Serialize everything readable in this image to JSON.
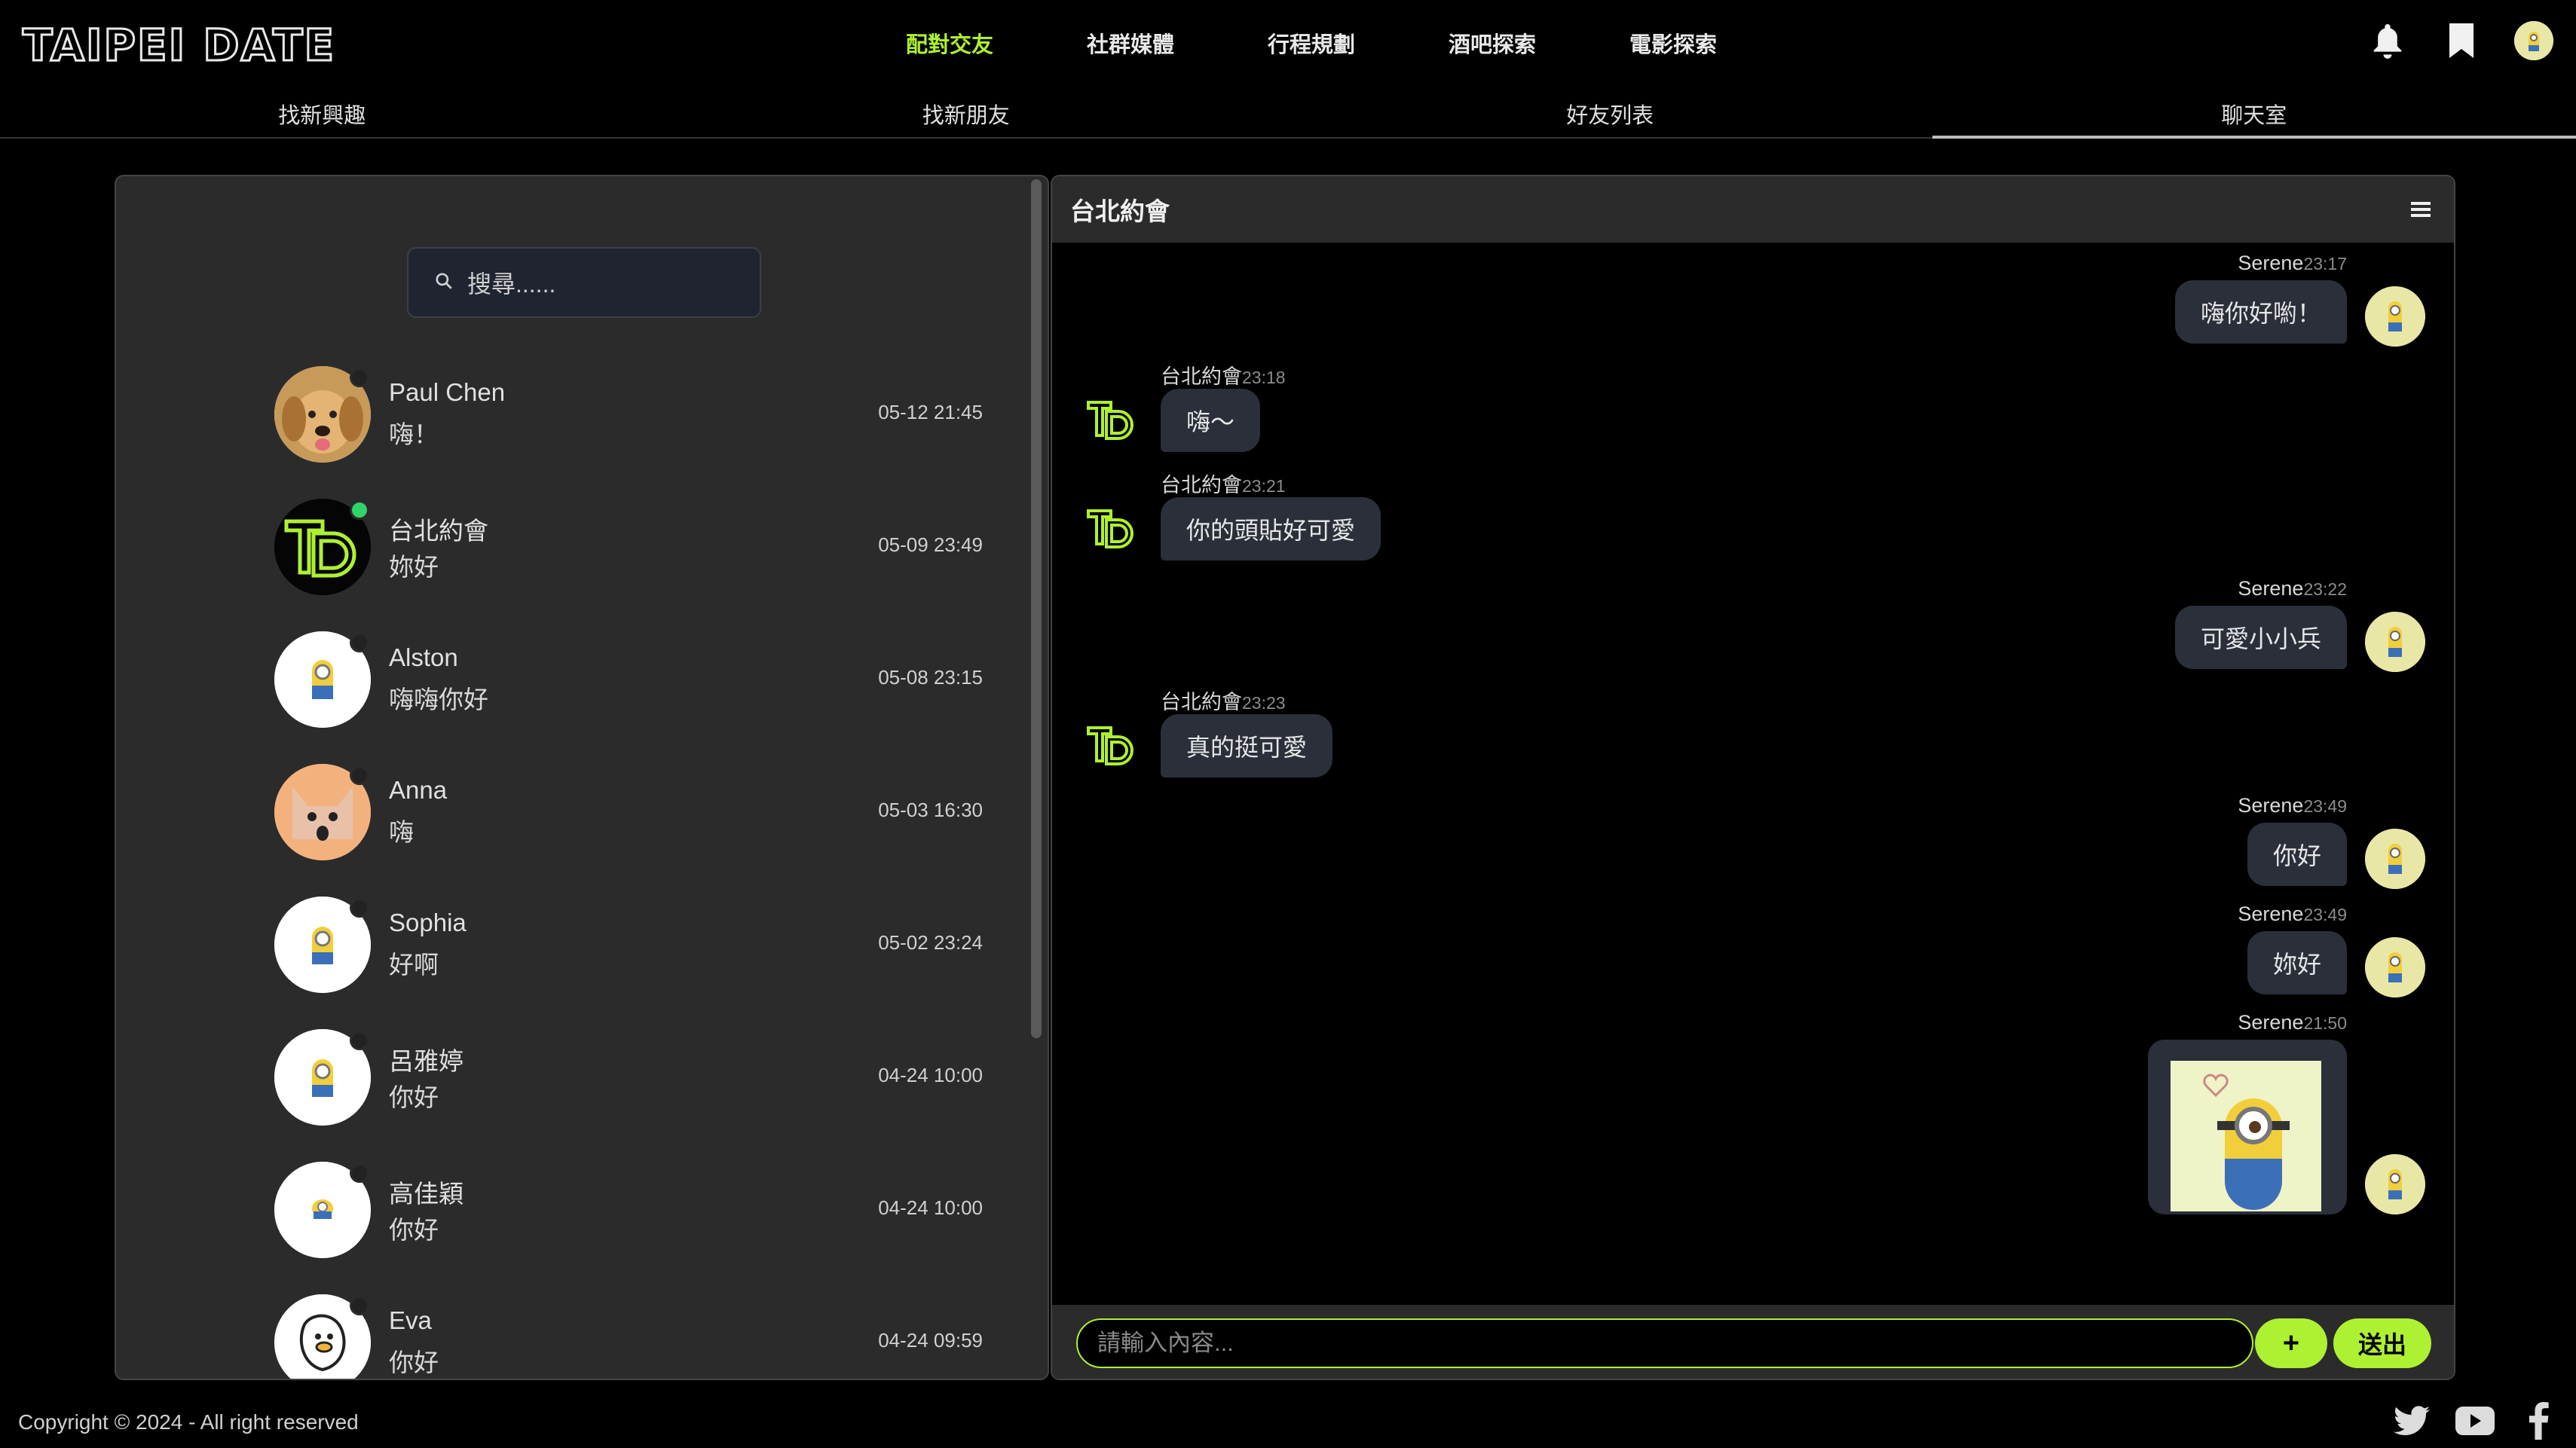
{
  "app": {
    "logo": "TAIPEI DATE"
  },
  "mainnav": [
    "配對交友",
    "社群媒體",
    "行程規劃",
    "酒吧探索",
    "電影探索"
  ],
  "mainnav_active": 0,
  "subtabs": [
    "找新興趣",
    "找新朋友",
    "好友列表",
    "聊天室"
  ],
  "subtabs_active": 3,
  "search": {
    "placeholder": "搜尋......"
  },
  "contacts": [
    {
      "name": "Paul Chen",
      "message": "嗨！",
      "time": "05-12 21:45",
      "online": false,
      "avatar": "dog"
    },
    {
      "name": "台北約會",
      "message": "妳好",
      "time": "05-09 23:49",
      "online": true,
      "avatar": "td"
    },
    {
      "name": "Alston",
      "message": "嗨嗨你好",
      "time": "05-08 23:15",
      "online": false,
      "avatar": "minion"
    },
    {
      "name": "Anna",
      "message": "嗨",
      "time": "05-03 16:30",
      "online": false,
      "avatar": "cat"
    },
    {
      "name": "Sophia",
      "message": "好啊",
      "time": "05-02 23:24",
      "online": false,
      "avatar": "minion"
    },
    {
      "name": "呂雅婷",
      "message": "你好",
      "time": "04-24 10:00",
      "online": false,
      "avatar": "minion"
    },
    {
      "name": "高佳穎",
      "message": "你好",
      "time": "04-24 10:00",
      "online": false,
      "avatar": "minion"
    },
    {
      "name": "Eva",
      "message": "你好",
      "time": "04-24 09:59",
      "online": false,
      "avatar": "duck"
    }
  ],
  "chat": {
    "title": "台北約會",
    "messages": [
      {
        "sender": "Serene",
        "time": "23:17",
        "text": "嗨你好喲！",
        "self": true
      },
      {
        "sender": "台北約會",
        "time": "23:18",
        "text": "嗨～",
        "self": false
      },
      {
        "sender": "台北約會",
        "time": "23:21",
        "text": "你的頭貼好可愛",
        "self": false
      },
      {
        "sender": "Serene",
        "time": "23:22",
        "text": "可愛小小兵",
        "self": true
      },
      {
        "sender": "台北約會",
        "time": "23:23",
        "text": "真的挺可愛",
        "self": false
      },
      {
        "sender": "Serene",
        "time": "23:49",
        "text": "你好",
        "self": true
      },
      {
        "sender": "Serene",
        "time": "23:49",
        "text": "妳好",
        "self": true
      },
      {
        "sender": "Serene",
        "time": "21:50",
        "text": "",
        "self": true,
        "image": true
      }
    ],
    "input_placeholder": "請輸入內容...",
    "plus_label": "+",
    "send_label": "送出"
  },
  "footer": {
    "copyright": "Copyright © 2024 - All right reserved"
  },
  "colors": {
    "accent": "#aef032",
    "panel": "#2b2b2b",
    "bubble": "#2a2f3a",
    "online": "#2fd46a"
  }
}
